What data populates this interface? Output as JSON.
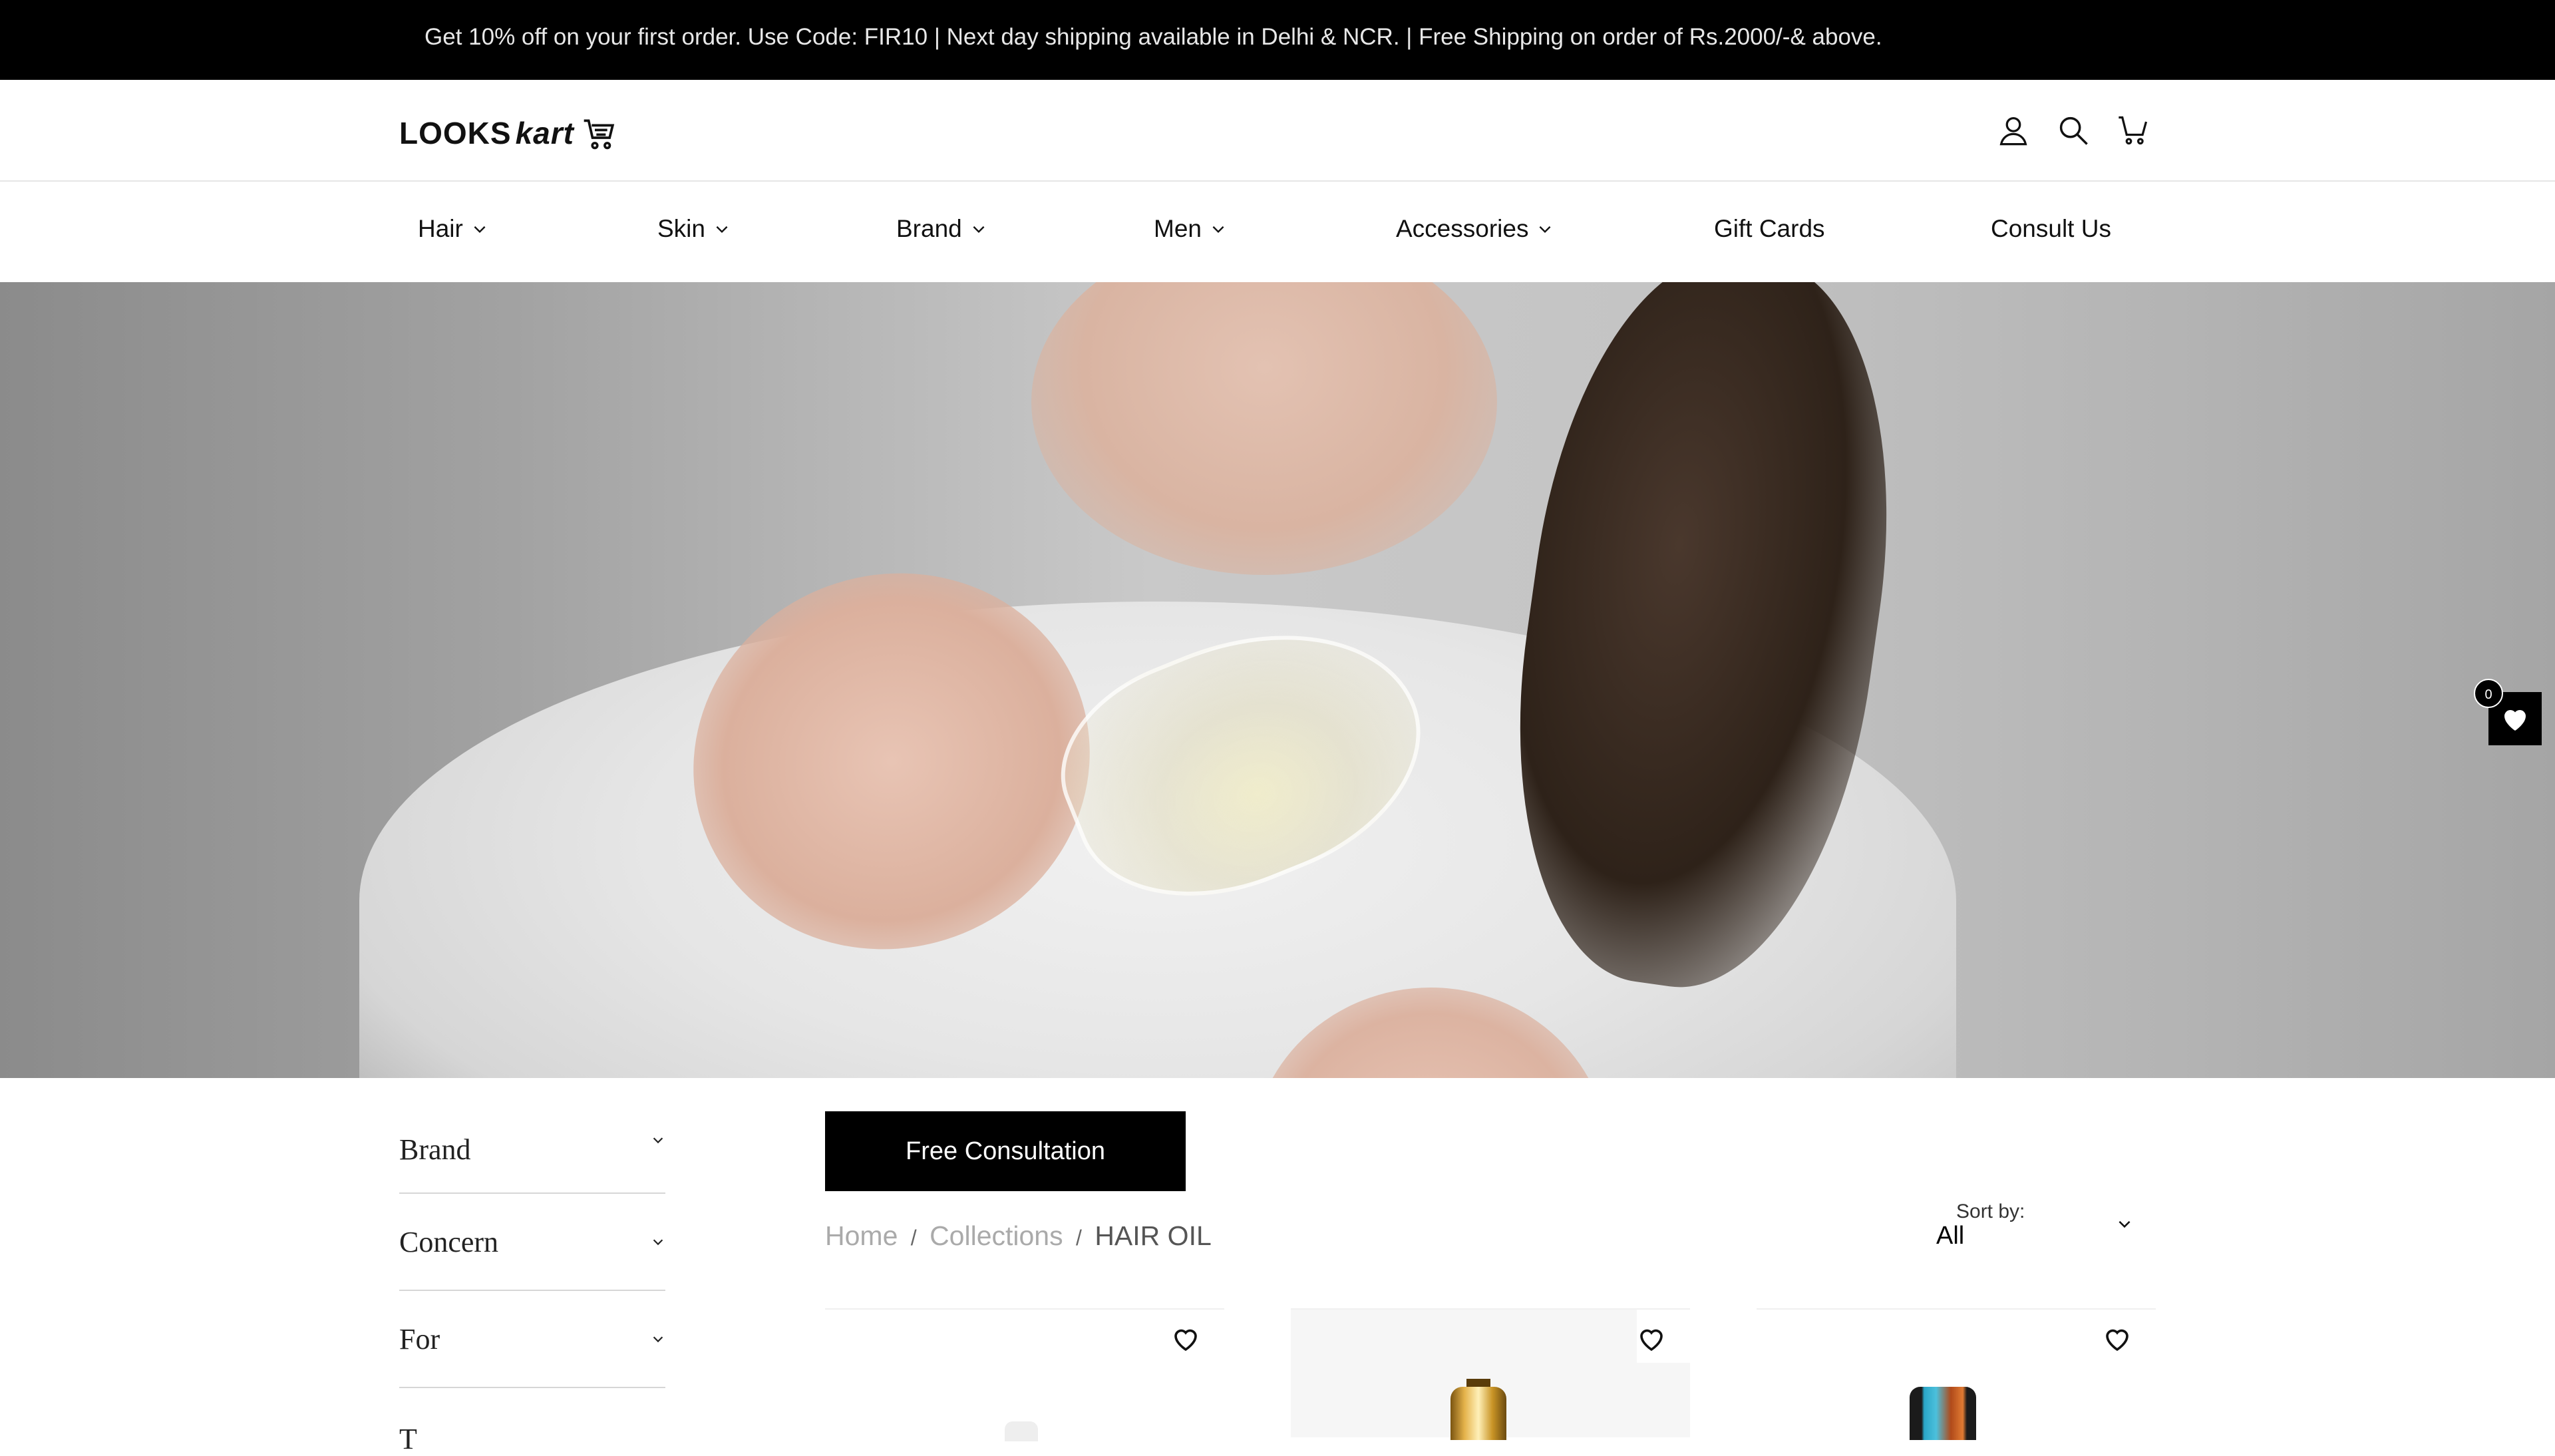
{
  "announcement": {
    "text": "Get 10% off on your first order. Use Code: FIR10 | Next day shipping available in Delhi & NCR. | Free Shipping on order of Rs.2000/-& above."
  },
  "header": {
    "logo": {
      "brand": "LOOKS",
      "brand_accent": "kart",
      "icon": "cart-icon"
    },
    "icons": [
      "account-icon",
      "search-icon",
      "cart-icon"
    ]
  },
  "nav": {
    "items": [
      {
        "label": "Hair",
        "has_dropdown": true
      },
      {
        "label": "Skin",
        "has_dropdown": true
      },
      {
        "label": "Brand",
        "has_dropdown": true
      },
      {
        "label": "Men",
        "has_dropdown": true
      },
      {
        "label": "Accessories",
        "has_dropdown": true
      },
      {
        "label": "Gift Cards",
        "has_dropdown": false
      },
      {
        "label": "Consult Us",
        "has_dropdown": false
      }
    ]
  },
  "wishlist": {
    "count": "0",
    "icon": "heart-icon"
  },
  "filters": {
    "items": [
      {
        "label": "Brand"
      },
      {
        "label": "Concern"
      },
      {
        "label": "For"
      },
      {
        "label": "T"
      }
    ]
  },
  "consultation": {
    "button_label": "Free Consultation"
  },
  "breadcrumb": {
    "home": "Home",
    "collections": "Collections",
    "current": "HAIR OIL",
    "separator": "/"
  },
  "sort": {
    "label": "Sort by:",
    "value": "All"
  },
  "products": [
    {
      "wishlist_icon": "heart-outline-icon"
    },
    {
      "wishlist_icon": "heart-outline-icon"
    },
    {
      "wishlist_icon": "heart-outline-icon"
    }
  ],
  "colors": {
    "announcement_bg": "#000000",
    "button_bg": "#000000",
    "button_text": "#ffffff",
    "breadcrumb_muted": "#aaaaaa"
  }
}
